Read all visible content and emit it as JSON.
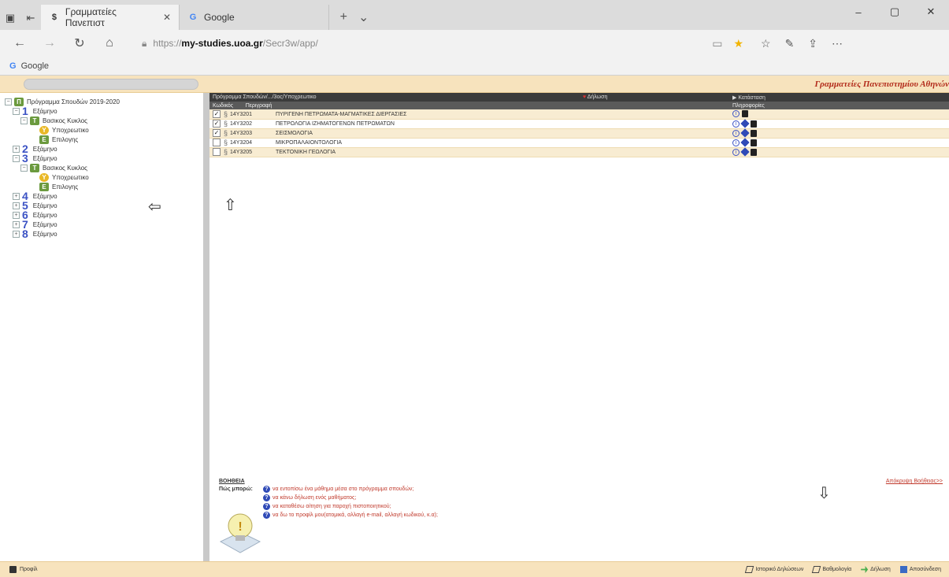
{
  "browser": {
    "tabs": [
      {
        "title": "Γραμματείες Πανεπιστ",
        "favicon": "$",
        "active": true
      },
      {
        "title": "Google",
        "favicon": "G",
        "active": false
      }
    ],
    "new_tab": "+",
    "tab_list": "⌄",
    "url_prefix": "https://",
    "url_host": "my-studies.uoa.gr",
    "url_path": "/Secr3w/app/",
    "favorites": [
      {
        "label": "Google",
        "icon": "G"
      }
    ],
    "window_controls": [
      "–",
      "▢",
      "✕"
    ]
  },
  "app": {
    "header_title": "Γραμματείες Πανεπιστημίου Αθηνών",
    "tree": {
      "root": "Πρόγραμμα Σπουδών 2019-2020",
      "semesters": [
        {
          "num": "1",
          "label": "Εξάμηνο",
          "expanded": true,
          "children": [
            {
              "label": "Βασικος Κυκλος",
              "children": [
                "Υποχρεωτικο",
                "Επιλογης"
              ]
            }
          ]
        },
        {
          "num": "2",
          "label": "Εξάμηνο",
          "expanded": false
        },
        {
          "num": "3",
          "label": "Εξάμηνο",
          "expanded": true,
          "children": [
            {
              "label": "Βασικος Κυκλος",
              "children": [
                "Υποχρεωτικο",
                "Επιλογης"
              ]
            }
          ]
        },
        {
          "num": "4",
          "label": "Εξάμηνο",
          "expanded": false
        },
        {
          "num": "5",
          "label": "Εξάμηνο",
          "expanded": false
        },
        {
          "num": "6",
          "label": "Εξάμηνο",
          "expanded": false
        },
        {
          "num": "7",
          "label": "Εξάμηνο",
          "expanded": false
        },
        {
          "num": "8",
          "label": "Εξάμηνο",
          "expanded": false
        }
      ]
    },
    "courses_table": {
      "breadcrumb": "Πρόγραμμα Σπουδών/.../3ος/Υποχρεωτικο",
      "declaration_label": "Δήλωση",
      "registration_label": "Κατάσταση",
      "col_code": "Κωδικός",
      "col_desc": "Περιγραφή",
      "col_info": "Πληροφορίες",
      "rows": [
        {
          "checked": true,
          "code": "14Υ3201",
          "title": "ΠΥΡΙΓΕΝΗ ΠΕΤΡΩΜΑΤΑ-ΜΑΓΜΑΤΙΚΕΣ ΔΙΕΡΓΑΣΙΕΣ",
          "diamond": false
        },
        {
          "checked": true,
          "code": "14Υ3202",
          "title": "ΠΕΤΡΟΛΟΓΙΑ ΙΖΗΜΑΤΟΓΕΝΩΝ ΠΕΤΡΩΜΑΤΩΝ",
          "diamond": true
        },
        {
          "checked": true,
          "code": "14Υ3203",
          "title": "ΣΕΙΣΜΟΛΟΓΙΑ",
          "diamond": true
        },
        {
          "checked": false,
          "code": "14Υ3204",
          "title": "ΜΙΚΡΟΠΑΛΑΙΟΝΤΟΛΟΓΙΑ",
          "diamond": true
        },
        {
          "checked": false,
          "code": "14Υ3205",
          "title": "ΤΕΚΤΟΝΙΚΗ ΓΕΩΛΟΓΙΑ",
          "diamond": true
        }
      ]
    },
    "help": {
      "title": "ΒΟΗΘΕΙΑ",
      "more": "Απόκρυψη Βοήθειας>>",
      "question": "Πώς μπορώ:",
      "links": [
        "να εντοπίσω ένα μάθημα μέσα στο πρόγραμμα σπουδών;",
        "να κάνω δήλωση ενός μαθήματος;",
        "να καταθέσω αίτηση για παροχή πιστοποιητικού;",
        "να δω το προφίλ μου(ατομικά, αλλαγή e-mail, αλλαγή κωδικού, κ.α);"
      ]
    },
    "footer": {
      "profile": "Προφίλ",
      "history": "Ιστορικό Δηλώσεων",
      "grades": "Βαθμολογία",
      "declaration": "Δήλωση",
      "logout": "Αποσύνδεση"
    }
  }
}
